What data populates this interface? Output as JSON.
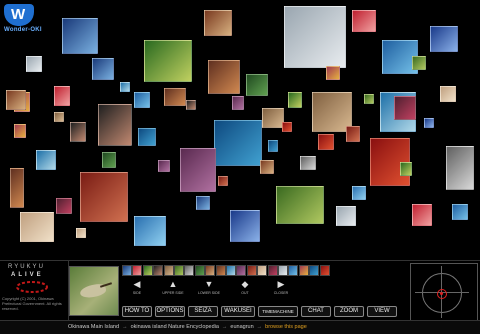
{
  "logo": {
    "letter": "W",
    "text": "Wonder-OKI"
  },
  "thumbnails": [
    {
      "name": "thumb-seabird",
      "colors": [
        "#1a3a7a",
        "#7ab0e0"
      ]
    },
    {
      "name": "thumb-pufferfish",
      "colors": [
        "#9aa6b0",
        "#e8ecef"
      ]
    },
    {
      "name": "thumb-castle-gate",
      "colors": [
        "#7a3a20",
        "#d7b080"
      ]
    },
    {
      "name": "thumb-flowers",
      "colors": [
        "#c02030",
        "#f0a0a0"
      ]
    },
    {
      "name": "thumb-coast",
      "colors": [
        "#1f5fa0",
        "#74c0e8"
      ]
    },
    {
      "name": "thumb-sanshin-player",
      "colors": [
        "#603020",
        "#d08850"
      ]
    },
    {
      "name": "thumb-frog",
      "colors": [
        "#2a6a20",
        "#c0d060"
      ]
    },
    {
      "name": "thumb-dancer",
      "colors": [
        "#a03a50",
        "#e6b040"
      ]
    },
    {
      "name": "thumb-beach",
      "colors": [
        "#1e70a8",
        "#b0d8e8"
      ]
    },
    {
      "name": "thumb-woman",
      "colors": [
        "#202020",
        "#c08870"
      ]
    },
    {
      "name": "thumb-sea-divers",
      "colors": [
        "#0e4a80",
        "#40a0d0"
      ]
    },
    {
      "name": "thumb-pottery",
      "colors": [
        "#5a2a50",
        "#b070a0"
      ]
    },
    {
      "name": "thumb-stone-texture",
      "colors": [
        "#806040",
        "#d8b890"
      ]
    },
    {
      "name": "thumb-shisa",
      "colors": [
        "#8a1010",
        "#e05030"
      ]
    },
    {
      "name": "thumb-palace",
      "colors": [
        "#7a1c14",
        "#d07050"
      ]
    },
    {
      "name": "thumb-grasshopper",
      "colors": [
        "#3a6a20",
        "#b0c860"
      ]
    },
    {
      "name": "thumb-vase",
      "colors": [
        "#1a3a8a",
        "#8ab0e8"
      ]
    },
    {
      "name": "thumb-coral",
      "colors": [
        "#c0a080",
        "#f0e0c8"
      ]
    },
    {
      "name": "thumb-dragon-carving",
      "colors": [
        "#606060",
        "#d8d8d8"
      ]
    },
    {
      "name": "thumb-lagoon",
      "colors": [
        "#2a70b0",
        "#90d0f0"
      ]
    },
    {
      "name": "thumb-musician",
      "colors": [
        "#502030",
        "#c04060"
      ]
    },
    {
      "name": "thumb-jungle",
      "colors": [
        "#204a20",
        "#60a050"
      ]
    }
  ],
  "brand": {
    "line1": "RYUKYU",
    "line2": "ALIVE",
    "copyright": "Copyright (C) 2001, Okinawa Prefectural Government. All rights reserved."
  },
  "nav_buttons": [
    {
      "name": "side-button",
      "label": "SIDE",
      "arrow": "◀"
    },
    {
      "name": "upper-side-button",
      "label": "UPPER SIDE",
      "arrow": "▲"
    },
    {
      "name": "lower-side-button",
      "label": "LOWER SIDE",
      "arrow": "▼"
    },
    {
      "name": "out-button",
      "label": "OUT",
      "arrow": "◆"
    },
    {
      "name": "closer-button",
      "label": "CLOSER",
      "arrow": "▶"
    }
  ],
  "menu": [
    {
      "name": "how-to-button",
      "label": "HOW TO"
    },
    {
      "name": "options-button",
      "label": "OPTIONS"
    },
    {
      "name": "seiza-button",
      "label": "SEIZA"
    },
    {
      "name": "wakusei-button",
      "label": "WAKUSEI"
    },
    {
      "name": "timemachine-button",
      "label": "TIMEMACHINE"
    },
    {
      "name": "chat-button",
      "label": "CHAT"
    },
    {
      "name": "zoom-button",
      "label": "ZOOM"
    },
    {
      "name": "view-button",
      "label": "VIEW"
    }
  ],
  "breadcrumb": {
    "item1": "Okinawa Main Island",
    "item2": "okinawa island Nature Encyclopedia",
    "item3": "eunagrun",
    "link": "browse this page",
    "separator": "→"
  }
}
